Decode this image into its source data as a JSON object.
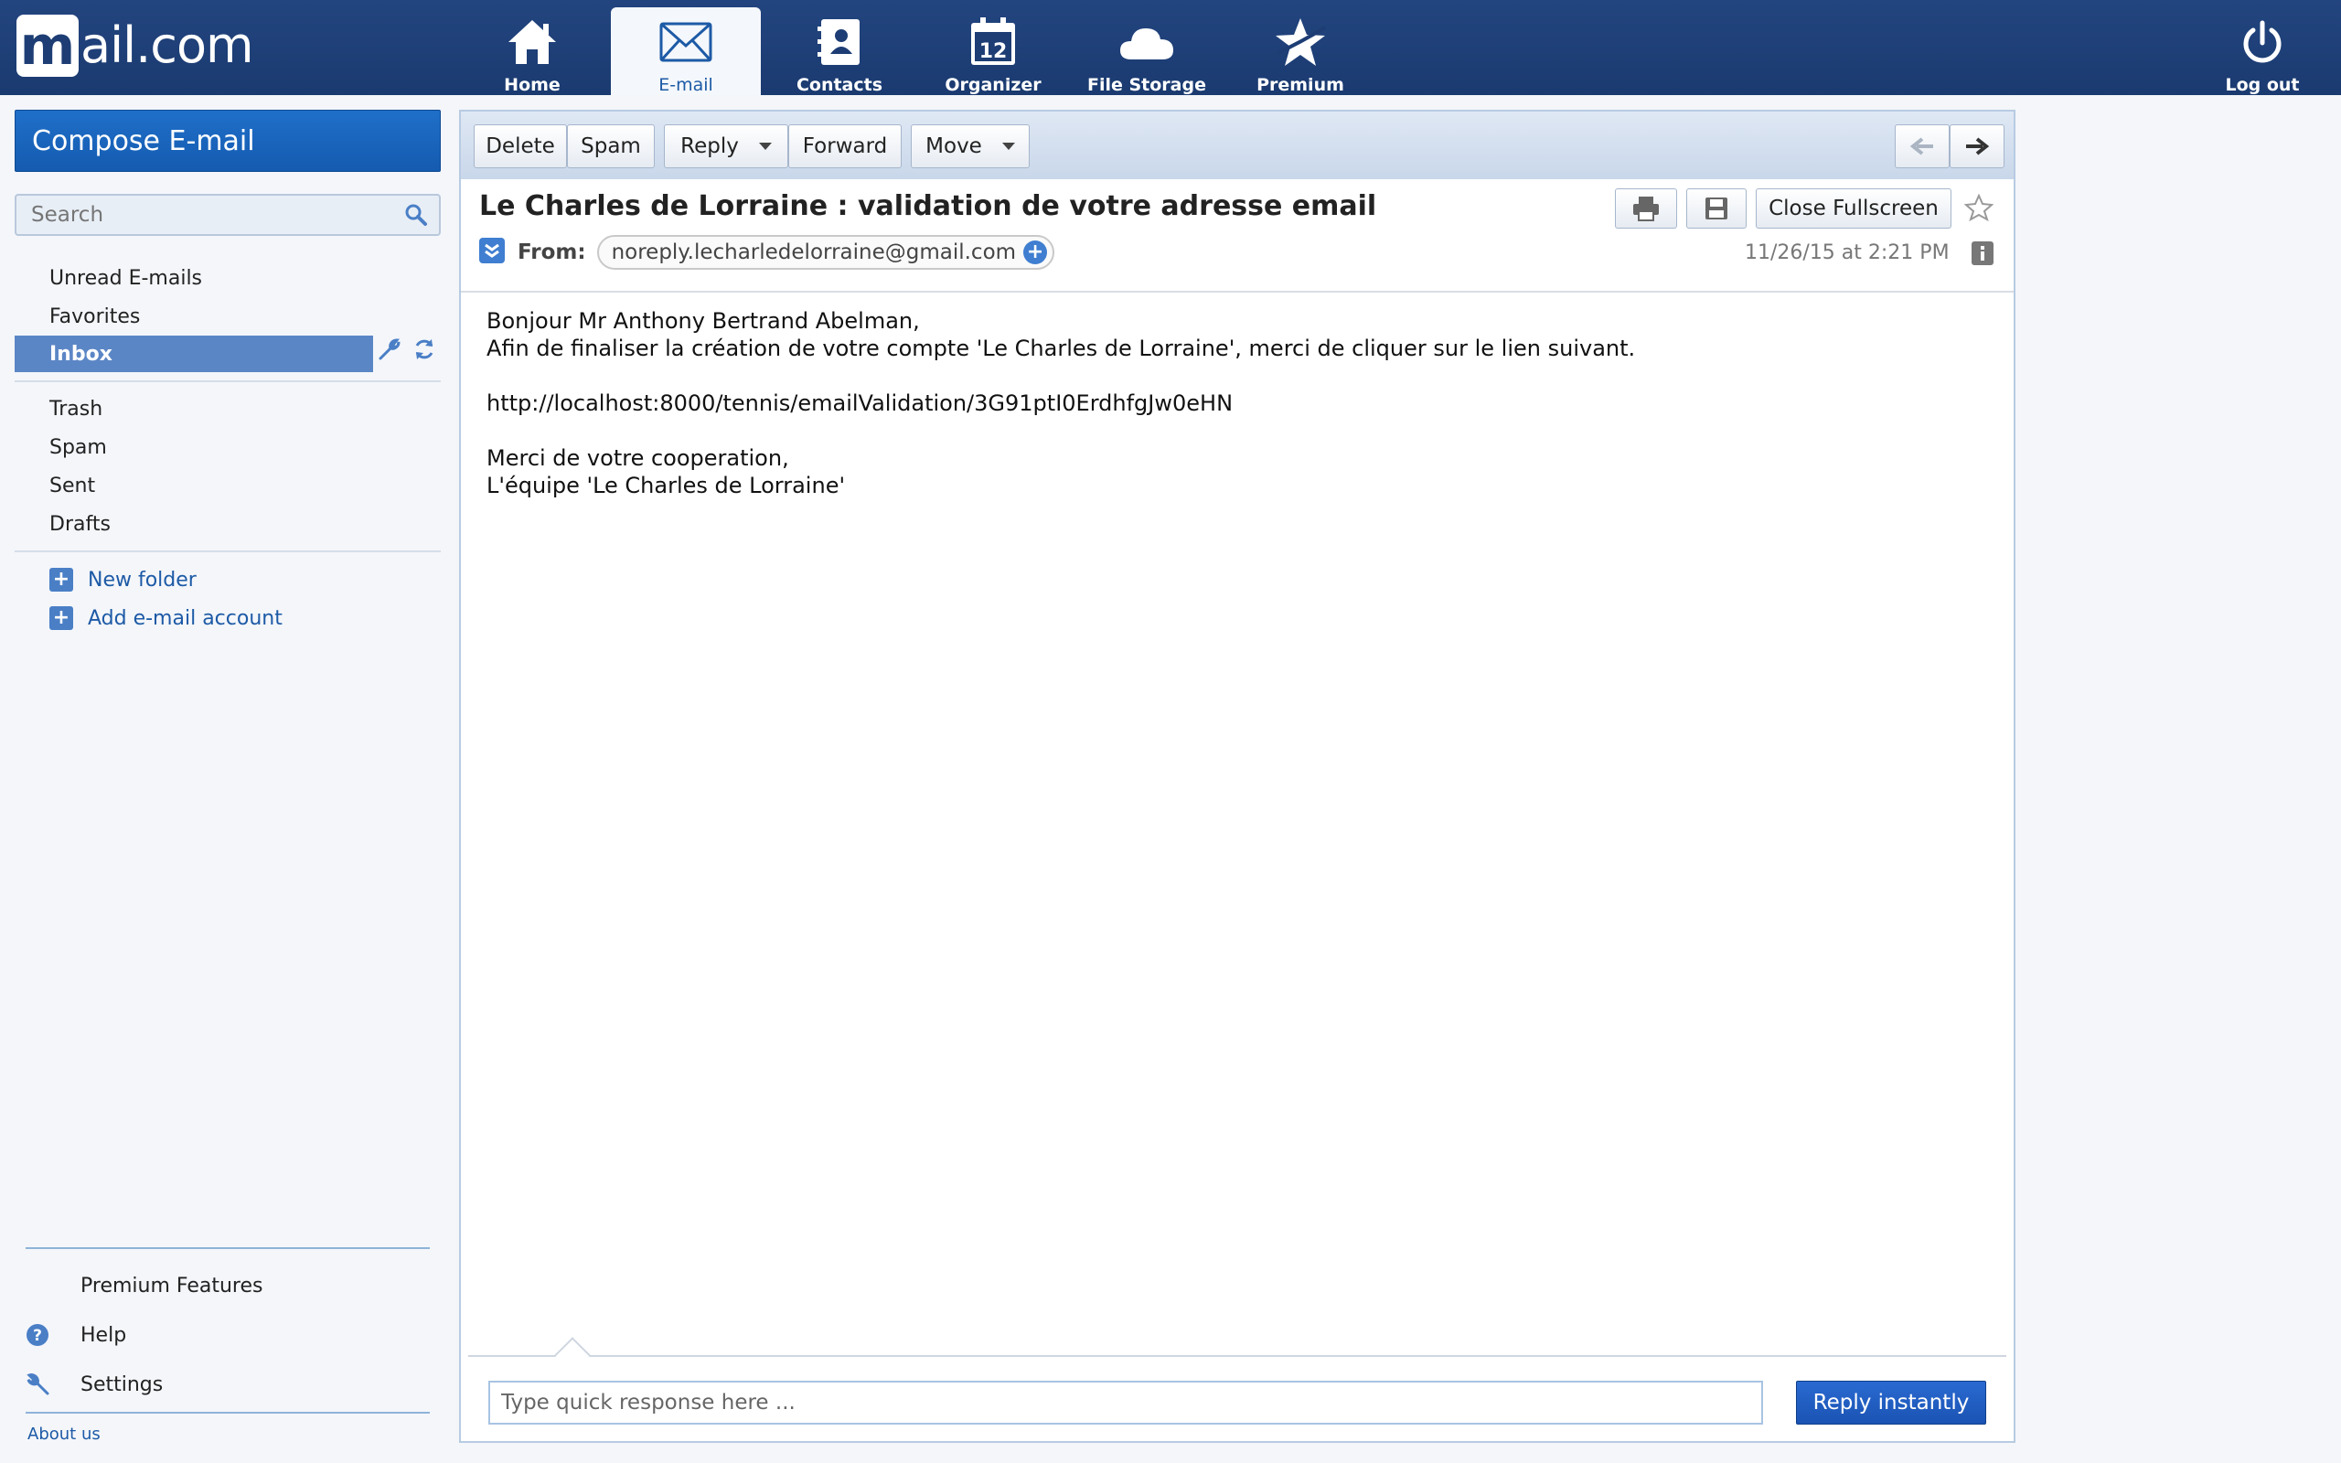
{
  "brand": {
    "logo_letter": "m",
    "logo_text": "ail.com"
  },
  "nav": {
    "home": "Home",
    "email": "E-mail",
    "contacts": "Contacts",
    "organizer": "Organizer",
    "organizer_day": "12",
    "storage": "File Storage",
    "premium": "Premium",
    "logout": "Log out"
  },
  "sidebar": {
    "compose": "Compose E-mail",
    "search_placeholder": "Search",
    "folders": {
      "unread": "Unread E-mails",
      "favorites": "Favorites",
      "inbox": "Inbox",
      "trash": "Trash",
      "spam": "Spam",
      "sent": "Sent",
      "drafts": "Drafts"
    },
    "new_folder": "New folder",
    "add_account": "Add e-mail account",
    "premium_features": "Premium Features",
    "help": "Help",
    "settings": "Settings",
    "about": "About us"
  },
  "toolbar": {
    "delete": "Delete",
    "spam": "Spam",
    "reply": "Reply",
    "forward": "Forward",
    "move": "Move"
  },
  "message": {
    "subject": "Le Charles de Lorraine : validation de votre adresse email",
    "from_label": "From:",
    "from": "noreply.lecharledelorraine@gmail.com",
    "date": "11/26/15 at 2:21 PM",
    "close_fullscreen": "Close Fullscreen",
    "body": "Bonjour Mr Anthony Bertrand Abelman,\nAfin de finaliser la création de votre compte 'Le Charles de Lorraine', merci de cliquer sur le lien suivant.\n\nhttp://localhost:8000/tennis/emailValidation/3G91ptI0ErdhfgJw0eHN\n\nMerci de votre cooperation,\nL'équipe 'Le Charles de Lorraine'"
  },
  "quick_reply": {
    "placeholder": "Type quick response here ...",
    "button": "Reply instantly"
  },
  "colors": {
    "topbar": "#1d3d74",
    "accent": "#1a5ab5",
    "inbox_highlight": "#5b86c6"
  }
}
